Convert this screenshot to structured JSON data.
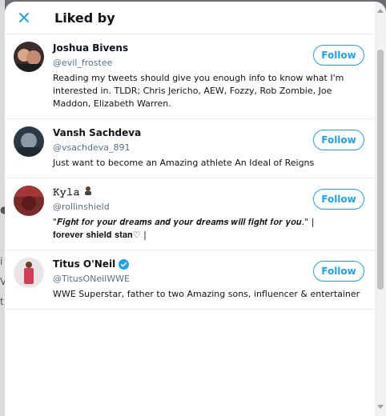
{
  "dialog": {
    "title": "Liked by",
    "accent_color": "#1da1f2"
  },
  "users": [
    {
      "name": "Joshua Bivens",
      "handle": "@evil_frostee",
      "bio": "Reading my tweets should give you enough info to know what I'm interested in. TLDR; Chris Jericho, AEW, Fozzy, Rob Zombie, Joe Maddon, Elizabeth Warren.",
      "follow_label": "Follow"
    },
    {
      "name": "Vansh Sachdeva",
      "handle": "@vsachdeva_891",
      "bio": "Just want to become an Amazing athlete An Ideal of Reigns",
      "follow_label": "Follow"
    },
    {
      "name": "𝙺𝚢𝚕𝚊",
      "handle": "@rollinshield",
      "bio_quote": "\"𝑭𝒊𝒈𝒉𝒕 𝒇𝒐𝒓 𝒚𝒐𝒖𝒓 𝒅𝒓𝒆𝒂𝒎𝒔 𝒂𝒏𝒅 𝒚𝒐𝒖𝒓 𝒅𝒓𝒆𝒂𝒎𝒔 𝒘𝒊𝒍𝒍 𝒇𝒊𝒈𝒉𝒕 𝒇𝒐𝒓 𝒚𝒐𝒖.\" |",
      "bio_rest": "𝐟𝐨𝐫𝐞𝐯𝐞𝐫 𝐬𝐡𝐢𝐞𝐥𝐝 𝐬𝐭𝐚𝐧♡ |",
      "follow_label": "Follow"
    },
    {
      "name": "Titus O'Neil",
      "handle": "@TitusONeilWWE",
      "bio": "WWE Superstar, father to two Amazing sons, influencer & entertainer",
      "follow_label": "Follow"
    }
  ]
}
